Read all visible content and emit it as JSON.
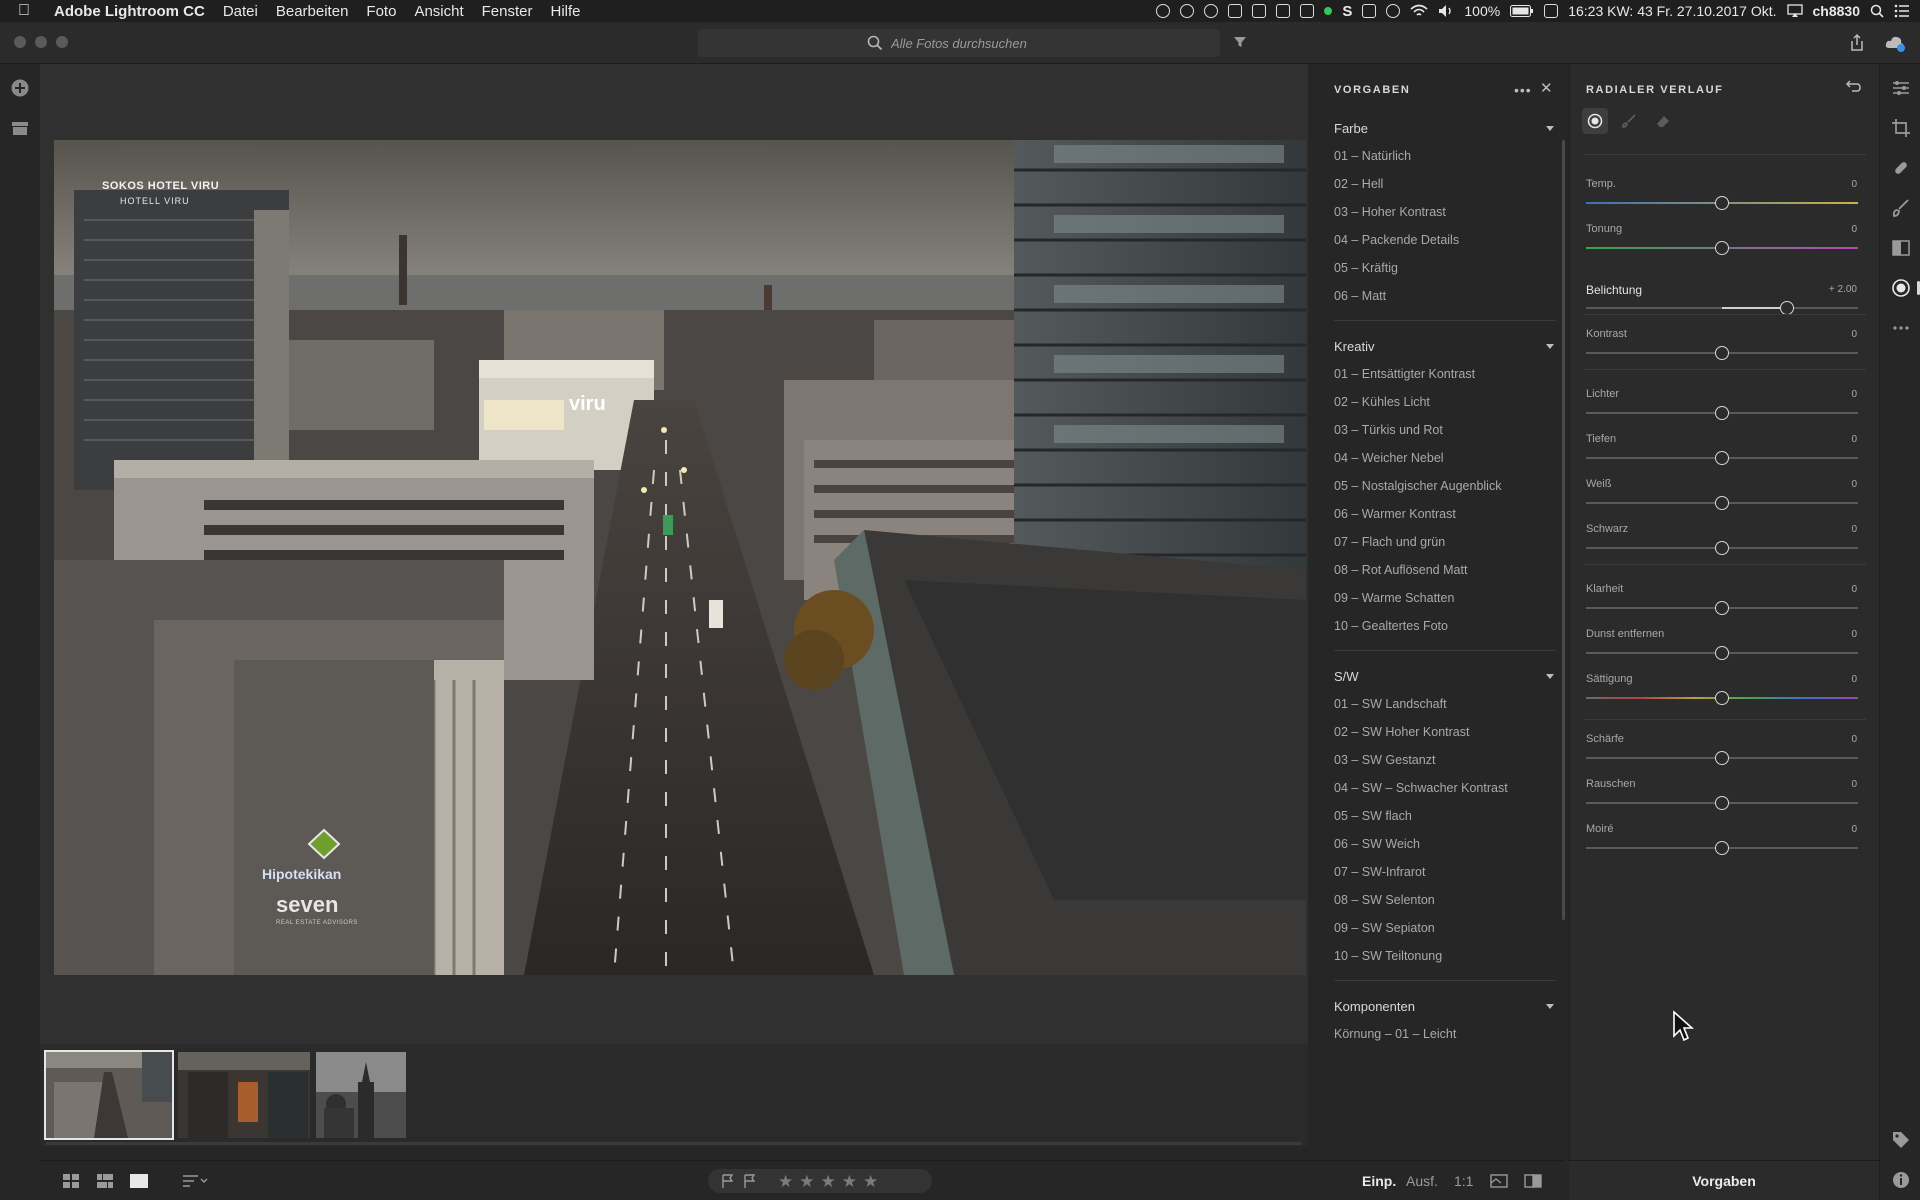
{
  "menubar": {
    "app_name": "Adobe Lightroom CC",
    "items": [
      "Datei",
      "Bearbeiten",
      "Foto",
      "Ansicht",
      "Fenster",
      "Hilfe"
    ],
    "battery": "100%",
    "datetime": "16:23 KW: 43 Fr. 27.10.2017 Okt.",
    "user": "ch8830"
  },
  "search": {
    "placeholder": "Alle Fotos durchsuchen"
  },
  "presets": {
    "title": "VORGABEN",
    "groups": [
      {
        "title": "Farbe",
        "items": [
          "01 – Natürlich",
          "02 – Hell",
          "03 – Hoher Kontrast",
          "04 – Packende Details",
          "05 – Kräftig",
          "06 – Matt"
        ]
      },
      {
        "title": "Kreativ",
        "items": [
          "01 – Entsättigter Kontrast",
          "02 – Kühles Licht",
          "03 – Türkis und Rot",
          "04 – Weicher Nebel",
          "05 – Nostalgischer Augenblick",
          "06 – Warmer Kontrast",
          "07 – Flach und grün",
          "08 – Rot Auflösend Matt",
          "09 – Warme Schatten",
          "10 – Gealtertes Foto"
        ]
      },
      {
        "title": "S/W",
        "items": [
          "01 – SW Landschaft",
          "02 – SW Hoher Kontrast",
          "03 – SW Gestanzt",
          "04 – SW – Schwacher Kontrast",
          "05 – SW flach",
          "06 – SW Weich",
          "07 – SW-Infrarot",
          "08 – SW Selenton",
          "09 – SW Sepiaton",
          "10 – SW Teiltonung"
        ]
      },
      {
        "title": "Komponenten",
        "items": [
          "Körnung – 01 – Leicht"
        ]
      }
    ]
  },
  "edit": {
    "title": "RADIALER VERLAUF",
    "sliders": [
      {
        "label": "Temp.",
        "value": "0",
        "fraction": 0.5
      },
      {
        "label": "Tonung",
        "value": "0",
        "fraction": 0.5
      },
      {
        "label": "Belichtung",
        "value": "+ 2.00",
        "fraction": 0.74
      },
      {
        "label": "Kontrast",
        "value": "0",
        "fraction": 0.5
      },
      {
        "label": "Lichter",
        "value": "0",
        "fraction": 0.5
      },
      {
        "label": "Tiefen",
        "value": "0",
        "fraction": 0.5
      },
      {
        "label": "Weiß",
        "value": "0",
        "fraction": 0.5
      },
      {
        "label": "Schwarz",
        "value": "0",
        "fraction": 0.5
      },
      {
        "label": "Klarheit",
        "value": "0",
        "fraction": 0.5
      },
      {
        "label": "Dunst entfernen",
        "value": "0",
        "fraction": 0.5
      },
      {
        "label": "Sättigung",
        "value": "0",
        "fraction": 0.5
      },
      {
        "label": "Schärfe",
        "value": "0",
        "fraction": 0.5
      },
      {
        "label": "Rauschen",
        "value": "0",
        "fraction": 0.5
      },
      {
        "label": "Moiré",
        "value": "0",
        "fraction": 0.5
      }
    ]
  },
  "photo": {
    "signs": {
      "hotel_line1": "SOKOS HOTEL VIRU",
      "hotel_line2": "HOTELL VIRU",
      "viru": "viru",
      "hipo": "Hipotekikan",
      "seven": "seven",
      "seven_sub": "REAL ESTATE ADVISORS"
    }
  },
  "bottombar": {
    "view_fit": "Einp.",
    "view_fill": "Ausf.",
    "view_1to1": "1:1",
    "stars": [
      "★",
      "★",
      "★",
      "★",
      "★"
    ]
  },
  "tabs": {
    "vorgaben": "Vorgaben"
  },
  "colors": {
    "background": "#262626",
    "panel": "#2b2b2b",
    "text": "#cfcfcf"
  }
}
